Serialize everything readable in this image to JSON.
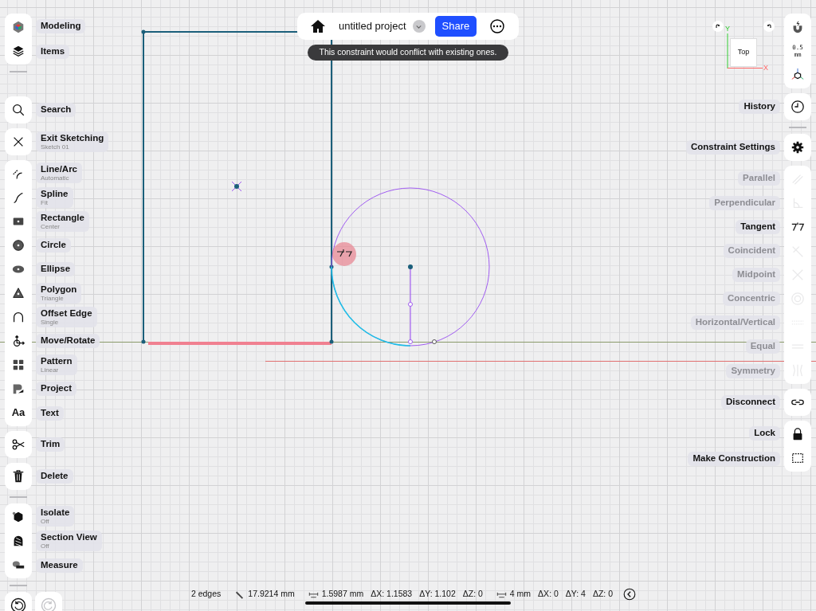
{
  "top_bar": {
    "title": "untitled project",
    "share_button": "Share"
  },
  "tooltip": "This constraint would conflict with existing ones.",
  "left_toolbar": {
    "groups": [
      {
        "separator_after": true,
        "items": [
          {
            "label": "Modeling"
          },
          {
            "label": "Items"
          }
        ]
      },
      {
        "separator_after": false,
        "items": [
          {
            "label": "Search"
          }
        ]
      },
      {
        "separator_after": false,
        "items": [
          {
            "label": "Exit Sketching",
            "sublabel": "Sketch 01"
          }
        ]
      },
      {
        "separator_after": false,
        "items": [
          {
            "label": "Line/Arc",
            "sublabel": "Automatic"
          },
          {
            "label": "Spline",
            "sublabel": "Fit"
          },
          {
            "label": "Rectangle",
            "sublabel": "Center"
          },
          {
            "label": "Circle"
          },
          {
            "label": "Ellipse"
          },
          {
            "label": "Polygon",
            "sublabel": "Triangle"
          },
          {
            "label": "Offset Edge",
            "sublabel": "Single"
          },
          {
            "label": "Move/Rotate"
          },
          {
            "label": "Pattern",
            "sublabel": "Linear"
          },
          {
            "label": "Project"
          },
          {
            "label": "Text",
            "icon_text": "Aa"
          }
        ]
      },
      {
        "separator_after": false,
        "items": [
          {
            "label": "Trim"
          }
        ]
      },
      {
        "separator_after": true,
        "items": [
          {
            "label": "Delete"
          }
        ]
      },
      {
        "separator_after": true,
        "items": [
          {
            "label": "Isolate",
            "sublabel": "Off"
          },
          {
            "label": "Section View",
            "sublabel": "Off"
          },
          {
            "label": "Measure"
          }
        ]
      }
    ],
    "undo": {
      "disabled": false
    },
    "redo": {
      "disabled": true
    }
  },
  "view_cube": {
    "face": "Top",
    "y_axis": "Y",
    "x_axis": "X"
  },
  "right_toolbar": {
    "groups": [
      {
        "separator_after": false,
        "items": [
          {
            "kind": "tool"
          },
          {
            "kind": "value",
            "value": "0.5 mm"
          },
          {
            "kind": "tool"
          }
        ]
      },
      {
        "separator_after": true,
        "items": [
          {
            "kind": "tool",
            "label": "History",
            "disabled": false
          }
        ]
      },
      {
        "separator_after": false,
        "items": [
          {
            "kind": "tool",
            "label": "Constraint Settings",
            "disabled": false
          }
        ]
      },
      {
        "separator_after": false,
        "items": [
          {
            "kind": "tool",
            "label": "Parallel",
            "disabled": true
          },
          {
            "kind": "tool",
            "label": "Perpendicular",
            "disabled": true
          },
          {
            "kind": "tool",
            "label": "Tangent",
            "disabled": false
          },
          {
            "kind": "tool",
            "label": "Coincident",
            "disabled": true
          },
          {
            "kind": "tool",
            "label": "Midpoint",
            "disabled": true
          },
          {
            "kind": "tool",
            "label": "Concentric",
            "disabled": true
          },
          {
            "kind": "tool",
            "label": "Horizontal/Vertical",
            "disabled": true
          },
          {
            "kind": "tool",
            "label": "Equal",
            "disabled": true
          },
          {
            "kind": "tool",
            "label": "Symmetry",
            "disabled": true
          }
        ]
      },
      {
        "separator_after": false,
        "items": [
          {
            "kind": "tool",
            "label": "Disconnect",
            "disabled": false
          }
        ]
      },
      {
        "separator_after": false,
        "items": [
          {
            "kind": "tool",
            "label": "Lock",
            "disabled": false
          },
          {
            "kind": "tool",
            "label": "Make Construction",
            "disabled": false
          }
        ]
      }
    ]
  },
  "status_bar": {
    "items": [
      {
        "kind": "text",
        "text": "2 edges"
      },
      {
        "kind": "measure",
        "text": "17.9214 mm"
      },
      {
        "kind": "measure",
        "text": "1.5987 mm"
      },
      {
        "kind": "text",
        "text": "ΔX: 1.1583"
      },
      {
        "kind": "text",
        "text": "ΔY: 1.102"
      },
      {
        "kind": "text",
        "text": "ΔZ: 0"
      },
      {
        "kind": "measure",
        "text": "4 mm"
      },
      {
        "kind": "text",
        "text": "ΔX: 0"
      },
      {
        "kind": "text",
        "text": "ΔY: 4"
      },
      {
        "kind": "text",
        "text": "ΔZ: 0"
      }
    ]
  }
}
